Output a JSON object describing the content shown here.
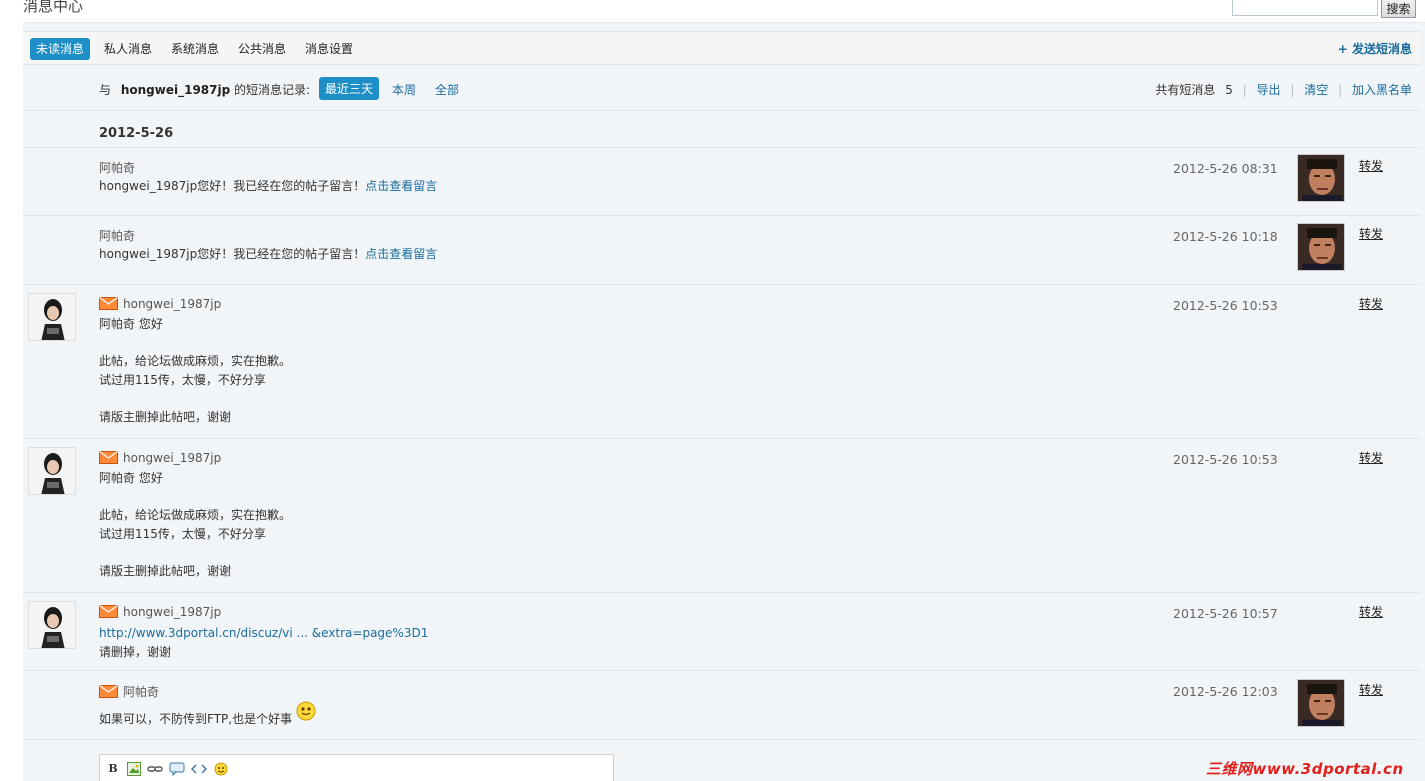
{
  "header": {
    "title": "消息中心",
    "search_button": "搜索"
  },
  "tabs": [
    {
      "label": "未读消息",
      "active": true
    },
    {
      "label": "私人消息"
    },
    {
      "label": "系统消息"
    },
    {
      "label": "公共消息"
    },
    {
      "label": "消息设置"
    }
  ],
  "send_message": "+ 发送短消息",
  "filter": {
    "prefix": "与",
    "user": "hongwei_1987jp",
    "suffix": "的短消息记录:",
    "options": [
      "最近三天",
      "本周",
      "全部"
    ],
    "count_label": "共有短消息",
    "count": "5",
    "actions": [
      "导出",
      "清空",
      "加入黑名单"
    ]
  },
  "date_heading": "2012-5-26",
  "messages": [
    {
      "author": "阿帕奇",
      "lines": [
        "hongwei_1987jp您好！我已经在您的帖子留言！"
      ],
      "link": "点击查看留言",
      "time": "2012-5-26 08:31",
      "forward": "转发"
    },
    {
      "author": "阿帕奇",
      "lines": [
        "hongwei_1987jp您好！我已经在您的帖子留言！"
      ],
      "link": "点击查看留言",
      "time": "2012-5-26 10:18",
      "forward": "转发"
    },
    {
      "author": "hongwei_1987jp",
      "lines": [
        "阿帕奇  您好",
        "",
        "此帖，给论坛做成麻烦，实在抱歉。",
        "试过用115传，太慢，不好分享",
        "",
        "请版主删掉此帖吧，谢谢"
      ],
      "time": "2012-5-26 10:53",
      "forward": "转发"
    },
    {
      "author": "hongwei_1987jp",
      "lines": [
        "阿帕奇  您好",
        "",
        "此帖，给论坛做成麻烦，实在抱歉。",
        "试过用115传，太慢，不好分享",
        "",
        "请版主删掉此帖吧，谢谢"
      ],
      "time": "2012-5-26 10:53",
      "forward": "转发"
    },
    {
      "author": "hongwei_1987jp",
      "link_line": "http://www.3dportal.cn/discuz/vi ... &extra=page%3D1",
      "lines": [
        "请删掉，谢谢"
      ],
      "time": "2012-5-26 10:57",
      "forward": "转发"
    },
    {
      "author": "阿帕奇",
      "lines": [
        "如果可以，不防传到FTP,也是个好事"
      ],
      "time": "2012-5-26 12:03",
      "forward": "转发"
    }
  ],
  "editor_toolbar": [
    "bold-icon",
    "image-icon",
    "link-icon",
    "quote-icon",
    "code-icon",
    "smiley-icon"
  ],
  "editor_bold": "B",
  "watermark": "三维网www.3dportal.cn",
  "colors": {
    "accent": "#1e8fc6",
    "link": "#1a6c9c",
    "watermark": "#e0201c"
  }
}
